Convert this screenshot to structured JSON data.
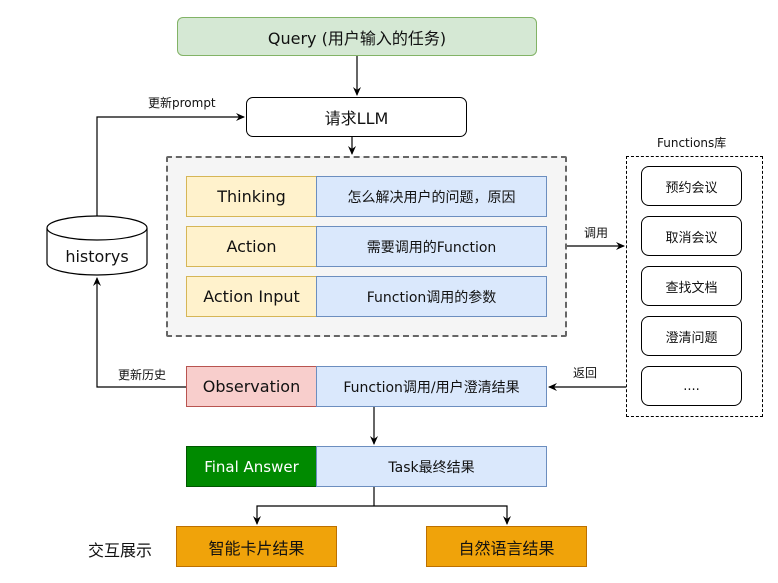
{
  "query": "Query (用户输入的任务)",
  "llm": "请求LLM",
  "rows": [
    {
      "key": "Thinking",
      "value": "怎么解决用户的问题，原因"
    },
    {
      "key": "Action",
      "value": "需要调用的Function"
    },
    {
      "key": "Action Input",
      "value": "Function调用的参数"
    }
  ],
  "observation": {
    "key": "Observation",
    "value": "Function调用/用户澄清结果"
  },
  "final": {
    "key": "Final Answer",
    "value": "Task最终结果"
  },
  "historys": "historys",
  "edge_labels": {
    "update_prompt": "更新prompt",
    "update_history": "更新历史",
    "call": "调用",
    "return": "返回"
  },
  "functions": {
    "title": "Functions库",
    "items": [
      "预约会议",
      "取消会议",
      "查找文档",
      "澄清问题",
      "...."
    ]
  },
  "display": {
    "label": "交互展示",
    "outputs": [
      "智能卡片结果",
      "自然语言结果"
    ]
  },
  "colors": {
    "query_fill": "#d5e8d4",
    "key_fill": "#fff2cc",
    "value_fill": "#dae8fc",
    "observation_fill": "#f8cecc",
    "final_fill": "#008a00",
    "output_fill": "#f0a30a"
  }
}
